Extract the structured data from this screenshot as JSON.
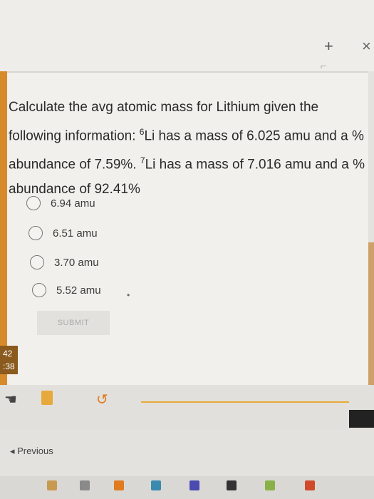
{
  "window": {
    "plus_label": "+",
    "close_label": "×"
  },
  "question": {
    "part1": "Calculate the avg atomic mass for Lithium given the following information: ",
    "sup6": "6",
    "part2": "Li has a mass of 6.025 amu and a % abundance of 7.59%. ",
    "sup7": "7",
    "part3": "Li has a mass of 7.016 amu and a % abundance of 92.41%"
  },
  "options": [
    "6.94 amu",
    "6.51 amu",
    "3.70 amu",
    "5.52 amu"
  ],
  "submit_label": "SUBMIT",
  "timer": {
    "minutes": "42",
    "seconds": ":38"
  },
  "nav": {
    "previous_label": "◂ Previous"
  },
  "colors": {
    "accent": "#d68a2a",
    "background": "#f1f0ec"
  }
}
